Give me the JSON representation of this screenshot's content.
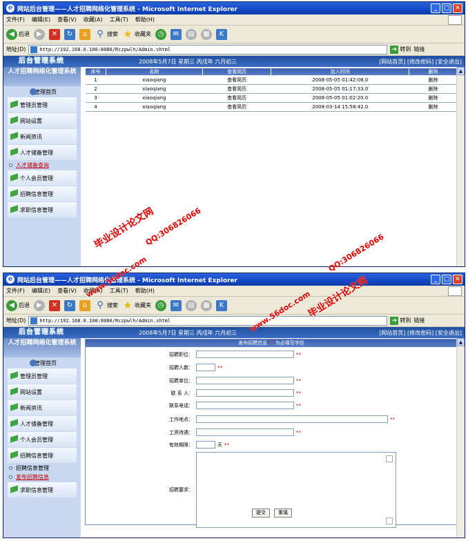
{
  "window": {
    "title": "网站后台管理——人才招聘网络化管理系统 - Microsoft Internet Explorer",
    "controls": {
      "min": "_",
      "max": "□",
      "close": "✕"
    }
  },
  "menubar": [
    "文件(F)",
    "编辑(E)",
    "查看(V)",
    "收藏(A)",
    "工具(T)",
    "帮助(H)"
  ],
  "toolbar": {
    "back": "后退",
    "search": "搜索",
    "favorites": "收藏夹"
  },
  "addressbar": {
    "label": "地址(D)",
    "url": "http://192.168.0.100:8080/Rczpwlh/Admin.shtml",
    "go": "转到",
    "links": "链接"
  },
  "header": {
    "logo": "后台管理系统",
    "date": "2008年5月7日 星期三 丙戌年 六月初三",
    "links": "[网站首页] [修改密码] [安全退出]"
  },
  "sidebar": {
    "system_title": "人才招聘网络化管理系统",
    "home": "管理首页",
    "items": [
      "管理员管理",
      "网站设置",
      "新闻资讯",
      "人才储备管理",
      "个人会员管理",
      "招聘信息管理",
      "求职信息管理"
    ],
    "sub_top": "人才储备查询",
    "items_bottom": [
      "管理员管理",
      "网站设置",
      "新闻资讯",
      "人才储备管理",
      "个人会员管理",
      "招聘信息管理"
    ],
    "sub_bottom_1": "招聘信息管理",
    "sub_bottom_2": "发布招聘信息",
    "last_item": "求职信息管理"
  },
  "table": {
    "headers": [
      "序号",
      "名称",
      "查看简历",
      "加入时间",
      "删除"
    ],
    "rows": [
      [
        "1",
        "xiaoqiang",
        "查看简历",
        "2008-05-05 01:42:08.0",
        "删除"
      ],
      [
        "2",
        "xiaoqiang",
        "查看简历",
        "2008-05-05 01:17:33.0",
        "删除"
      ],
      [
        "3",
        "xiaoqiang",
        "查看简历",
        "2008-05-05 01:02:20.0",
        "删除"
      ],
      [
        "4",
        "xiaoqiang",
        "查看简历",
        "2008-03-14 15:58:42.0",
        "删除"
      ]
    ]
  },
  "form": {
    "head_pre": "发布招聘信息",
    "head_req": "**",
    "head_post": "为必填写字段",
    "fields": [
      "招聘职位：",
      "招聘人数：",
      "招聘单位：",
      "联 系 人：",
      "联系电话：",
      "工作地点：",
      "工资待遇：",
      "有效期限：",
      "招聘要求："
    ],
    "day_unit": "天",
    "star": "**",
    "submit": "提交",
    "reset": "重填"
  },
  "watermarks": [
    "毕业设计论文网",
    "QQ:306826066",
    "www.56doc.com"
  ]
}
